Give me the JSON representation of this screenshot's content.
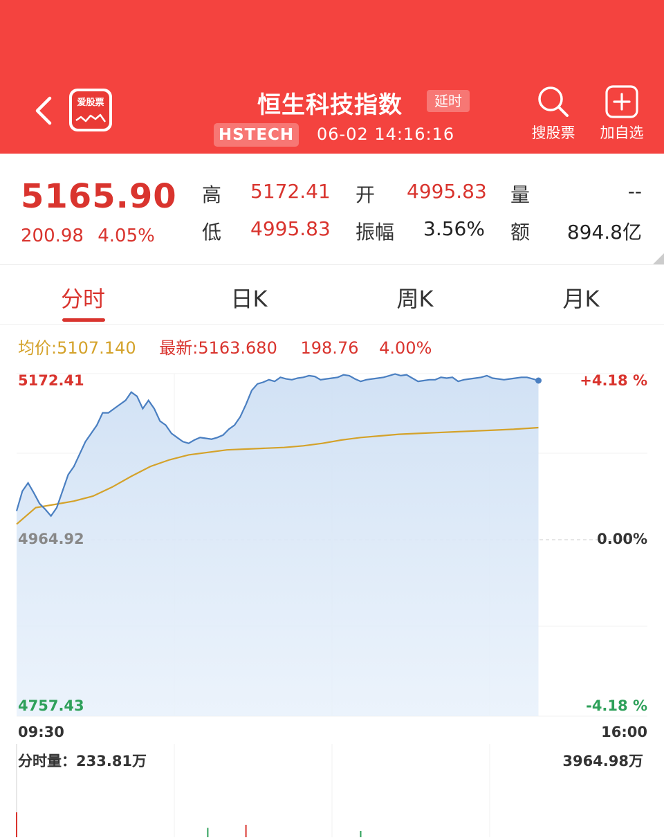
{
  "header": {
    "app_logo_text": "爱股票",
    "title": "恒生科技指数",
    "delay_badge": "延时",
    "code": "HSTECH",
    "datetime": "06-02 14:16:16",
    "search_label": "搜股票",
    "add_label": "加自选",
    "bg_color": "#f4433f"
  },
  "quote": {
    "price": "5165.90",
    "change": "200.98",
    "change_pct": "4.05%",
    "high_label": "高",
    "high": "5172.41",
    "open_label": "开",
    "open": "4995.83",
    "volume_label": "量",
    "volume": "--",
    "low_label": "低",
    "low": "4995.83",
    "amplitude_label": "振幅",
    "amplitude": "3.56%",
    "amount_label": "额",
    "amount": "894.8亿"
  },
  "tabs": [
    {
      "label": "分时",
      "active": true
    },
    {
      "label": "日K",
      "active": false
    },
    {
      "label": "周K",
      "active": false
    },
    {
      "label": "月K",
      "active": false
    }
  ],
  "info": {
    "avg": "均价:5107.140",
    "latest": "最新:5163.680",
    "change": "198.76",
    "change_pct": "4.00%"
  },
  "chart_labels": {
    "y_top": "5172.41",
    "y_mid": "4964.92",
    "y_bottom": "4757.43",
    "pct_top": "+4.18 %",
    "pct_mid": "0.00%",
    "pct_bottom": "-4.18 %",
    "time_start": "09:30",
    "time_end": "16:00",
    "volume_left": "分时量：233.81万",
    "volume_right": "3964.98万"
  },
  "chart_data": {
    "type": "line",
    "ylim": [
      4757.43,
      5172.41
    ],
    "x_range": [
      "09:30",
      "16:00"
    ],
    "series": [
      {
        "color": "#4a7fc1",
        "x": [
          0,
          3,
          6,
          9,
          12,
          15,
          18,
          21,
          24,
          27,
          30,
          33,
          36,
          39,
          42,
          45,
          48,
          51,
          54,
          57,
          60,
          63,
          66,
          69,
          72,
          75,
          78,
          81,
          84,
          87,
          90,
          93,
          96,
          99,
          102,
          105,
          108,
          111,
          114,
          117,
          120,
          123,
          126,
          129,
          132,
          135,
          138,
          141,
          144,
          147,
          150,
          153,
          156,
          159,
          162,
          165,
          168,
          171,
          174,
          177,
          180,
          183,
          186,
          189,
          192,
          195,
          198,
          201,
          204,
          207,
          210,
          213,
          216,
          219,
          222,
          225,
          228,
          231,
          234,
          237,
          240,
          243,
          246,
          249,
          252,
          255,
          258,
          261,
          264,
          267,
          270,
          273
        ],
        "y": [
          5006,
          5030,
          5040,
          5028,
          5015,
          5008,
          5000,
          5010,
          5030,
          5050,
          5060,
          5075,
          5090,
          5100,
          5110,
          5125,
          5125,
          5130,
          5135,
          5140,
          5150,
          5145,
          5130,
          5140,
          5130,
          5115,
          5110,
          5100,
          5095,
          5090,
          5088,
          5092,
          5095,
          5094,
          5093,
          5095,
          5098,
          5105,
          5110,
          5120,
          5135,
          5152,
          5160,
          5162,
          5165,
          5163,
          5168,
          5166,
          5165,
          5167,
          5168,
          5170,
          5169,
          5165,
          5166,
          5167,
          5168,
          5171,
          5170,
          5166,
          5163,
          5165,
          5166,
          5167,
          5168,
          5170,
          5172,
          5170,
          5171,
          5167,
          5163,
          5164,
          5165,
          5165,
          5168,
          5167,
          5168,
          5163,
          5165,
          5166,
          5167,
          5168,
          5170,
          5167,
          5166,
          5165,
          5166,
          5167,
          5168,
          5168,
          5166,
          5164
        ]
      },
      {
        "color": "#d4a22a",
        "x": [
          0,
          10,
          20,
          30,
          40,
          50,
          60,
          70,
          80,
          90,
          100,
          110,
          120,
          130,
          140,
          150,
          160,
          170,
          180,
          190,
          200,
          210,
          220,
          230,
          240,
          250,
          260,
          273
        ],
        "y": [
          4990,
          5010,
          5014,
          5018,
          5024,
          5035,
          5048,
          5060,
          5068,
          5074,
          5077,
          5080,
          5081,
          5082,
          5083,
          5085,
          5088,
          5092,
          5095,
          5097,
          5099,
          5100,
          5101,
          5102,
          5103,
          5104,
          5105,
          5107
        ]
      }
    ],
    "volume": {
      "x": [
        0,
        100,
        120,
        180
      ],
      "values": [
        0.4,
        0.15,
        0.2,
        0.1
      ]
    }
  }
}
